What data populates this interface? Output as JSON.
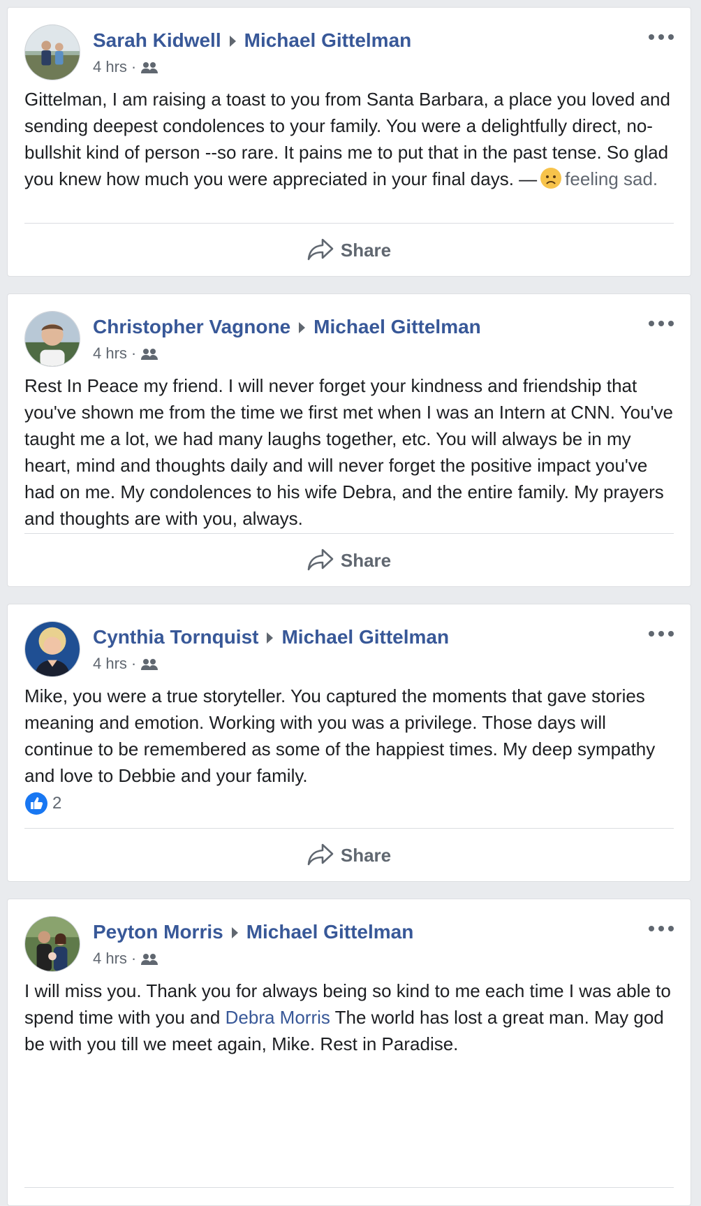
{
  "posts": [
    {
      "author": "Sarah Kidwell",
      "target": "Michael Gittelman",
      "time": "4 hrs",
      "dot": "·",
      "body": "Gittelman, I am raising a toast to you from Santa Barbara, a place you loved and sending deepest condolences to your family. You were a delightfully direct, no-bullshit kind of person --so rare. It pains me to put that in the past tense. So glad you knew how much you were appreciated in your final days. —",
      "feeling": "feeling sad.",
      "share_label": "Share"
    },
    {
      "author": "Christopher Vagnone",
      "target": "Michael Gittelman",
      "time": "4 hrs",
      "dot": "·",
      "body": "Rest In Peace my friend. I will never forget your kindness and friendship that you've shown me from the time we first met when I was an Intern at CNN. You've taught me a lot, we had many laughs together, etc. You will always be in my heart, mind and thoughts daily and will never forget the positive impact you've had on me. My condolences to his wife Debra, and the entire family. My prayers and thoughts are with you, always.",
      "share_label": "Share"
    },
    {
      "author": "Cynthia Tornquist",
      "target": "Michael Gittelman",
      "time": "4 hrs",
      "dot": "·",
      "body": "Mike, you were a true storyteller. You captured the moments that gave stories meaning and emotion. Working with you was a privilege. Those days will continue to be remembered as some of the happiest times. My deep sympathy and love to Debbie and your family.",
      "reaction_count": "2",
      "share_label": "Share"
    },
    {
      "author": "Peyton Morris",
      "target": "Michael Gittelman",
      "time": "4 hrs",
      "dot": "·",
      "body_before": "I will miss you. Thank you for always being so kind to me each time I was able to spend time with you and",
      "mention": "Debra Morris",
      "body_after": "The world has lost a great man. May god be with you till we meet again, Mike. Rest in Paradise."
    }
  ],
  "icons": {
    "audience": "friends-audience-icon",
    "more": "more-options-icon",
    "share": "share-arrow-icon",
    "like": "like-thumb-icon",
    "sad": "sad-face-emoji"
  },
  "colors": {
    "link": "#385898",
    "meta": "#606770",
    "like_blue": "#1877f2",
    "background": "#e9ebee"
  }
}
